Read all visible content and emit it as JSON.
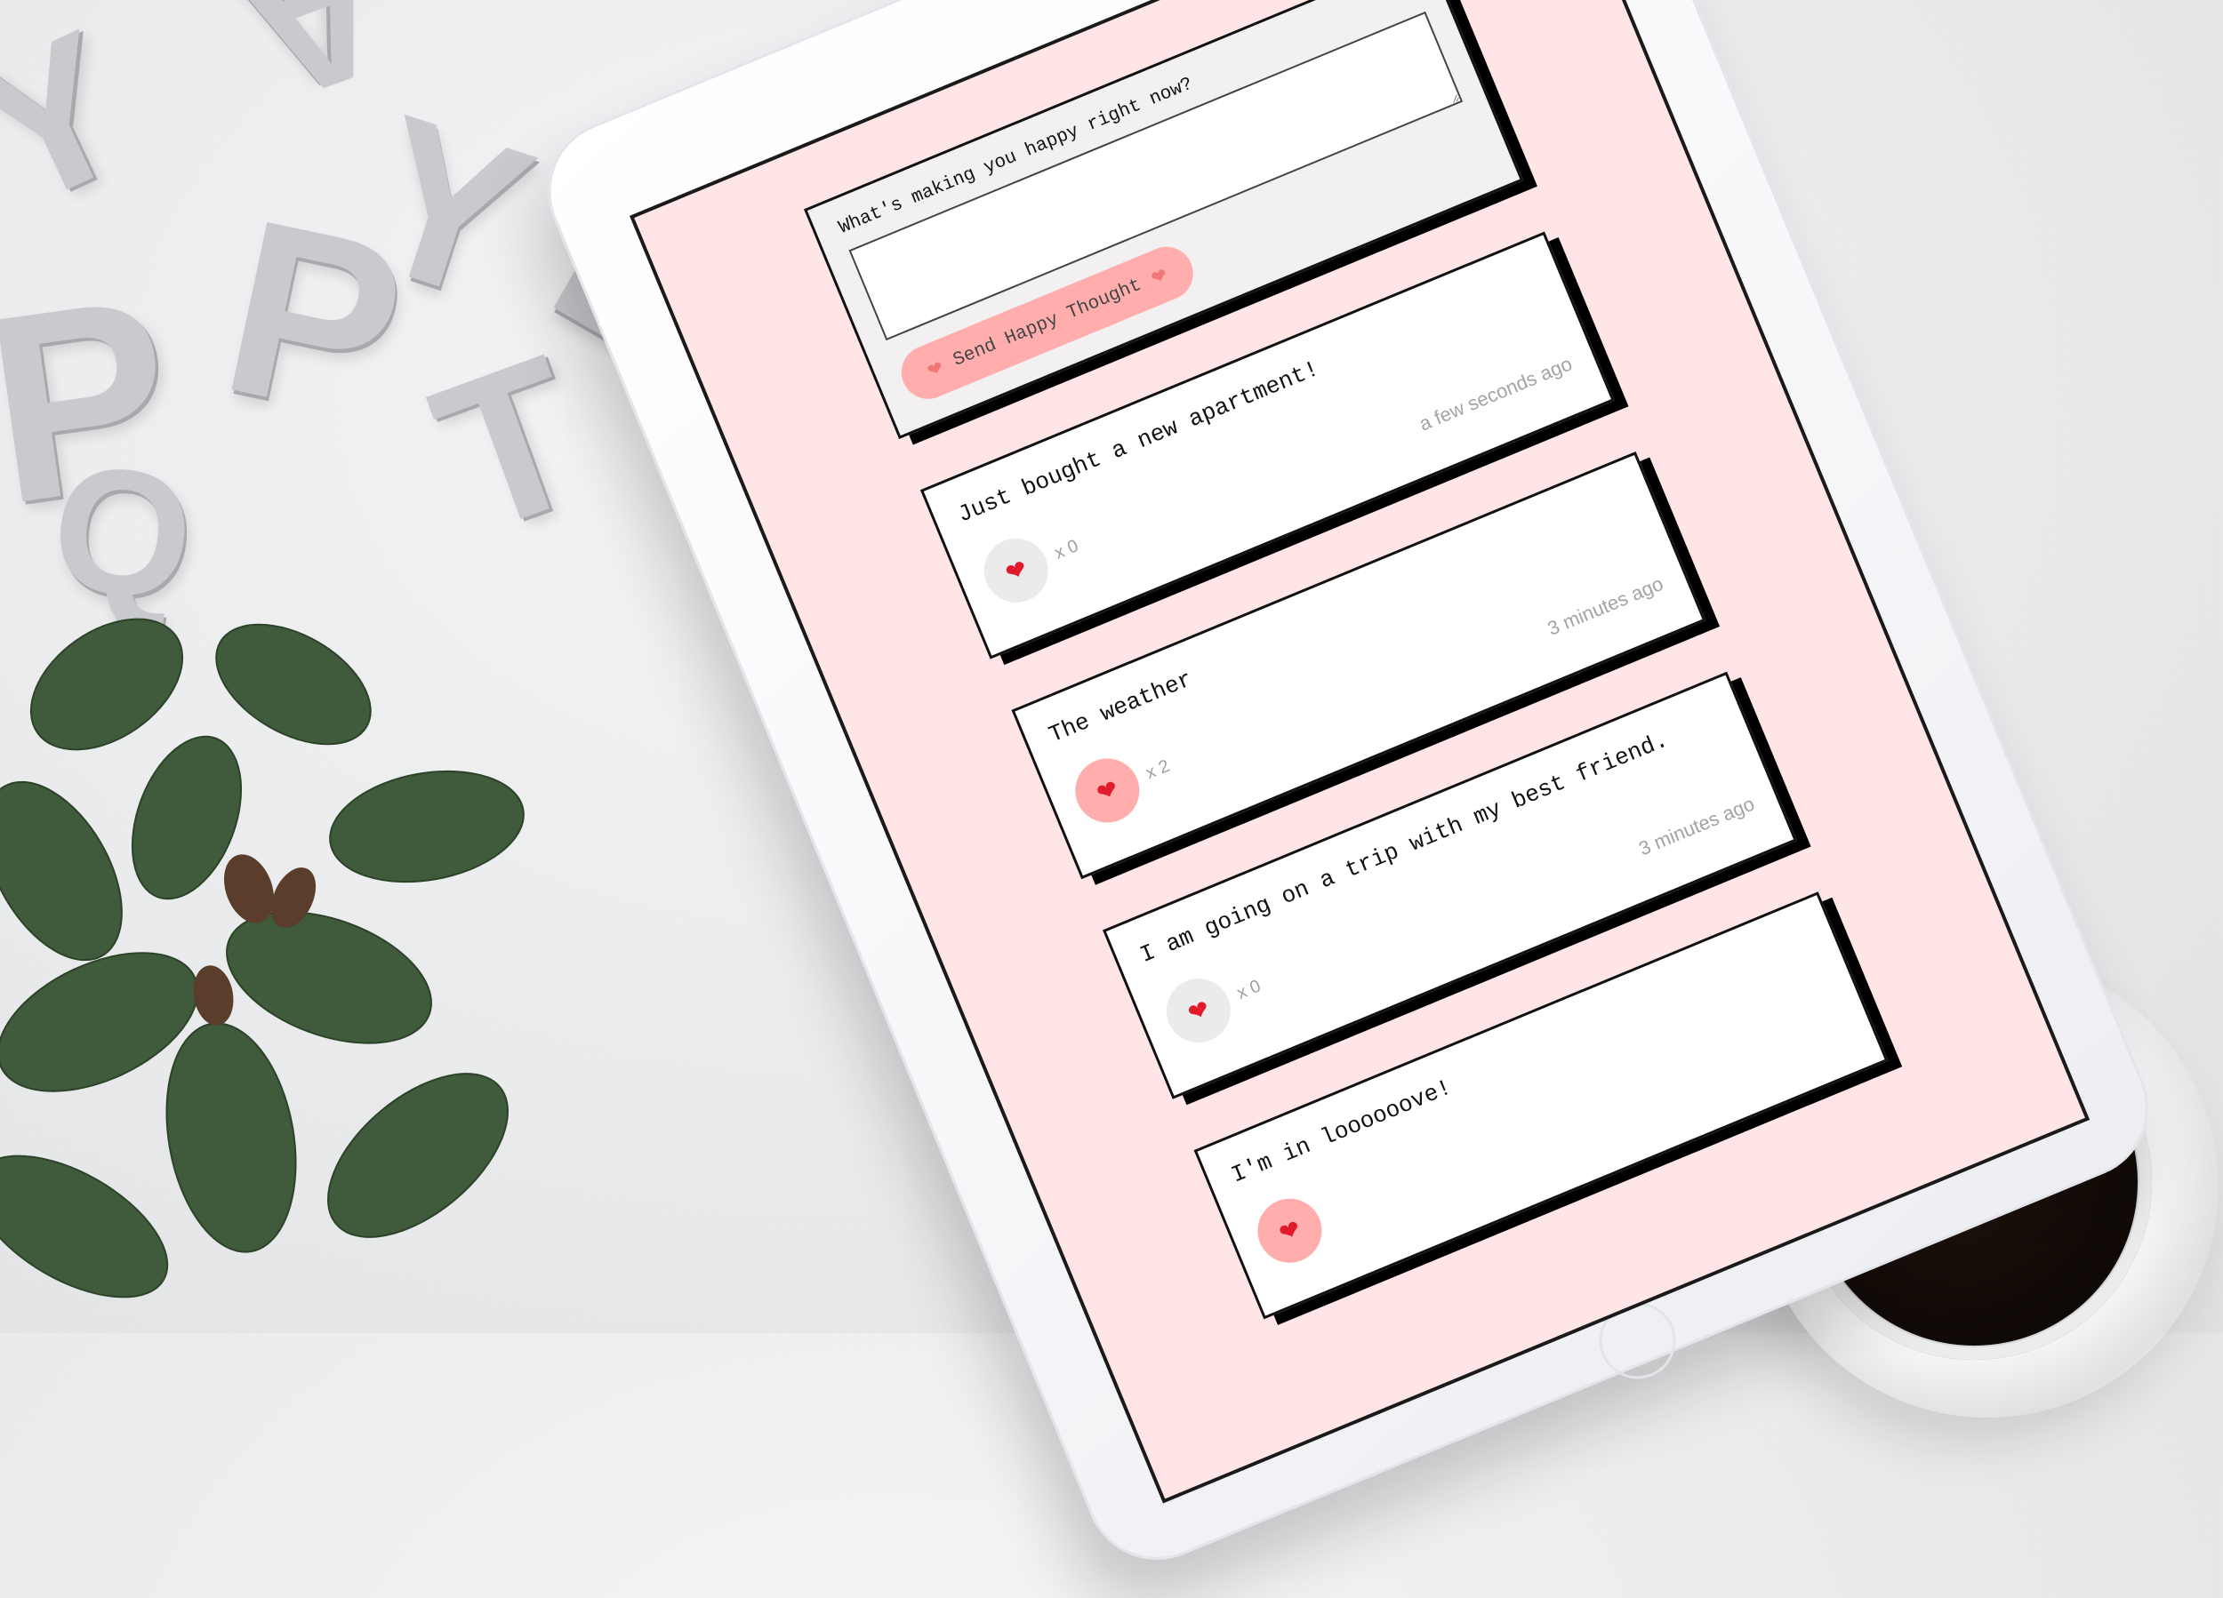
{
  "form": {
    "label": "What's making you happy right now?",
    "textarea_value": "",
    "send_label": "Send Happy Thought",
    "heart_glyph": "❤"
  },
  "thoughts": [
    {
      "message": "Just bought a new apartment!",
      "hearts": "x 0",
      "time": "a few seconds ago",
      "liked": false
    },
    {
      "message": "The weather",
      "hearts": "x 2",
      "time": "3 minutes ago",
      "liked": true
    },
    {
      "message": "I am going on a trip with my best friend.",
      "hearts": "x 0",
      "time": "3 minutes ago",
      "liked": false
    },
    {
      "message": "I'm in loooooove!",
      "hearts": "",
      "time": "",
      "liked": true
    }
  ],
  "colors": {
    "screen_bg": "#ffe5e5",
    "accent": "#ffadad",
    "heart": "#e21b2c",
    "card_border": "#111111"
  },
  "decor": {
    "letters": [
      "Y",
      "A",
      "P",
      "P",
      "Y",
      "E",
      "T",
      "Q"
    ]
  }
}
